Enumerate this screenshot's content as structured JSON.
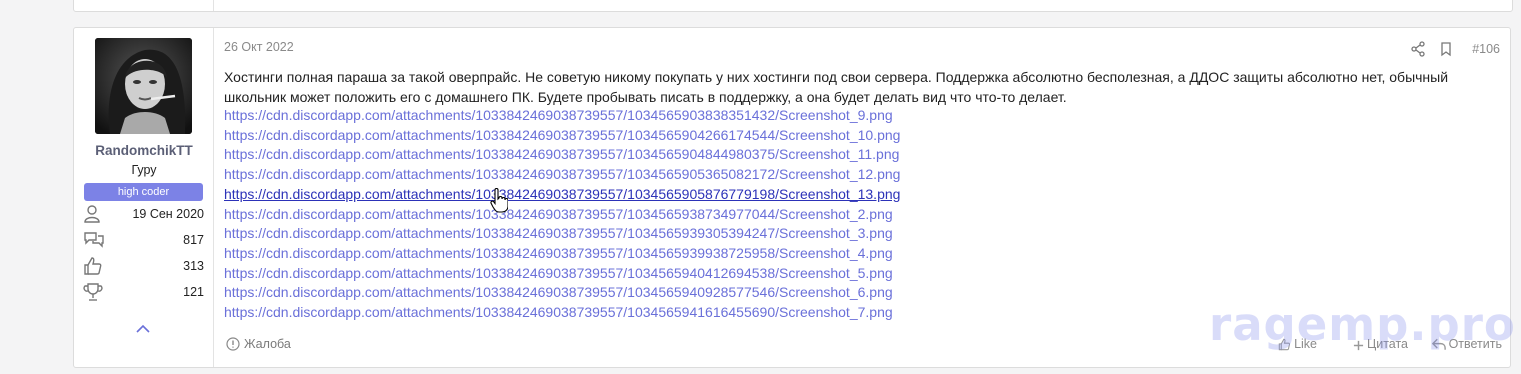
{
  "author": {
    "username": "RandomchikTT",
    "title": "Гуру",
    "badge": "high coder",
    "stats": [
      {
        "icon": "user-icon",
        "value": "19 Сен 2020"
      },
      {
        "icon": "messages-icon",
        "value": "817"
      },
      {
        "icon": "thumbs-up-icon",
        "value": "313"
      },
      {
        "icon": "trophy-icon",
        "value": "121"
      }
    ]
  },
  "post": {
    "date": "26 Окт 2022",
    "number": "#106",
    "text": "Хостинги полная параша за такой оверпрайс. Не советую никому покупать у них хостинги под свои сервера. Поддержка абсолютно бесполезная, а ДДОС защиты абсолютно нет, обычный школьник может положить его с домашнего ПК. Будете пробывать писать в поддержку, а она будет делать вид что что-то делает.",
    "links": [
      "https://cdn.discordapp.com/attachments/1033842469038739557/1034565903838351432/Screenshot_9.png",
      "https://cdn.discordapp.com/attachments/1033842469038739557/1034565904266174544/Screenshot_10.png",
      "https://cdn.discordapp.com/attachments/1033842469038739557/1034565904844980375/Screenshot_11.png",
      "https://cdn.discordapp.com/attachments/1033842469038739557/1034565905365082172/Screenshot_12.png",
      "https://cdn.discordapp.com/attachments/1033842469038739557/1034565905876779198/Screenshot_13.png",
      "https://cdn.discordapp.com/attachments/1033842469038739557/1034565938734977044/Screenshot_2.png",
      "https://cdn.discordapp.com/attachments/1033842469038739557/1034565939305394247/Screenshot_3.png",
      "https://cdn.discordapp.com/attachments/1033842469038739557/1034565939938725958/Screenshot_4.png",
      "https://cdn.discordapp.com/attachments/1033842469038739557/1034565940412694538/Screenshot_5.png",
      "https://cdn.discordapp.com/attachments/1033842469038739557/1034565940928577546/Screenshot_6.png",
      "https://cdn.discordapp.com/attachments/1033842469038739557/1034565941616455690/Screenshot_7.png"
    ],
    "hovered_link_index": 4
  },
  "footer": {
    "report_label": "Жалоба",
    "like_label": "Like",
    "quote_label": "Цитата",
    "reply_label": "Ответить"
  },
  "watermark": "ragemp.pro",
  "colors": {
    "link": "#6a70d9",
    "link_hover": "#2c32b8",
    "badge": "#7c82e6",
    "username": "#5b5f76"
  }
}
